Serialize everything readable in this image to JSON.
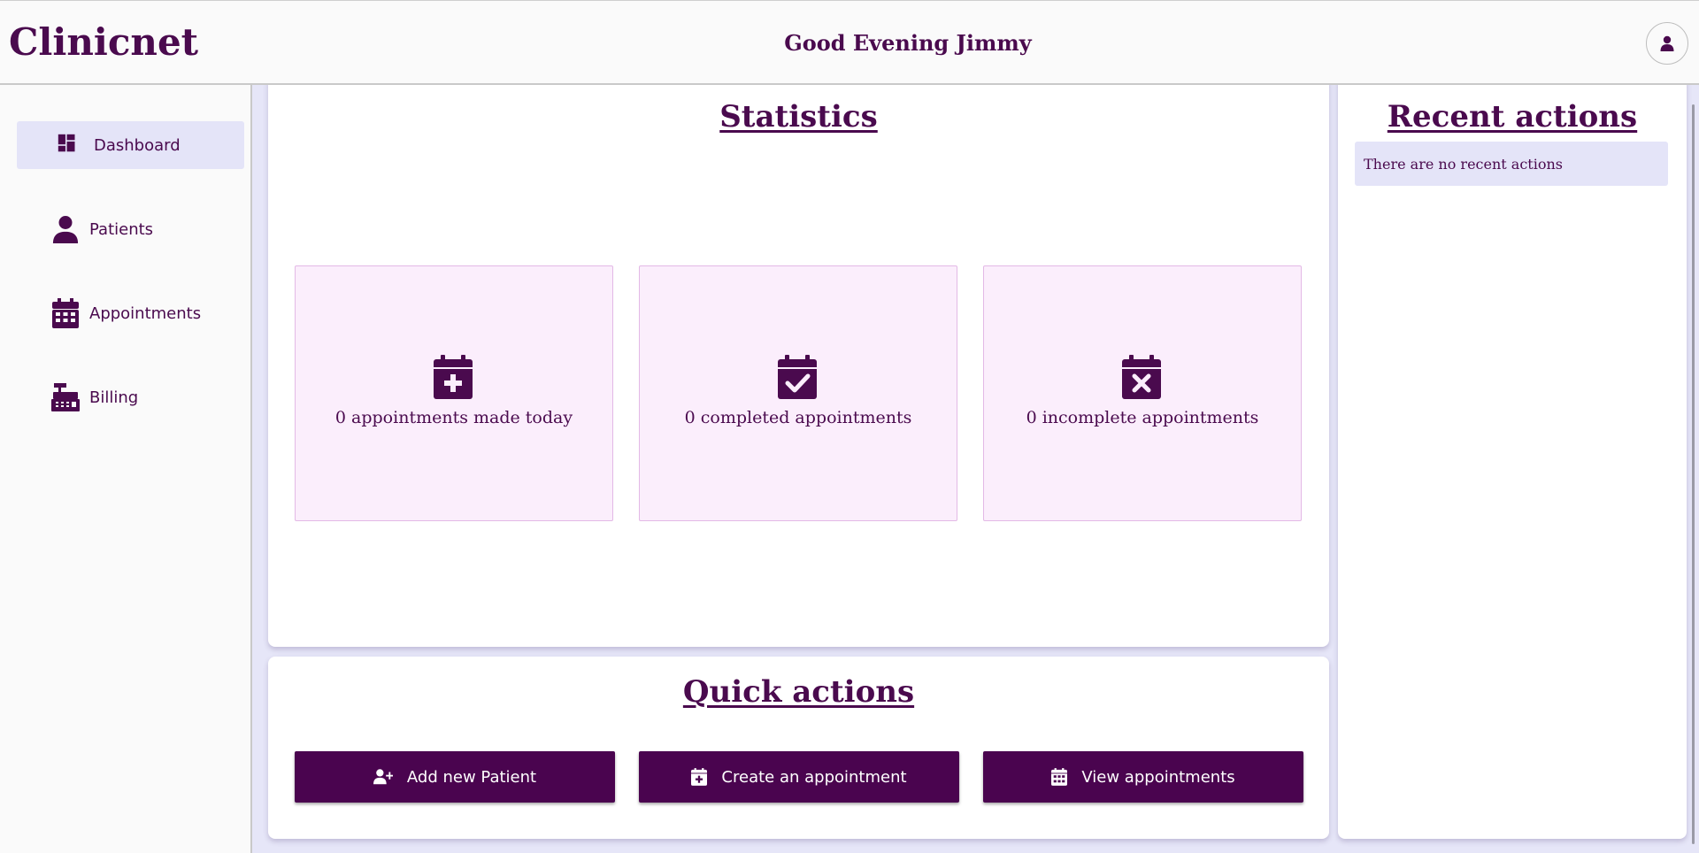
{
  "app": {
    "brand": "Clinicnet",
    "greeting": "Good Evening Jimmy",
    "avatar_icon": "user-icon"
  },
  "sidebar": {
    "items": [
      {
        "label": "Dashboard",
        "icon": "dashboard-icon",
        "active": true
      },
      {
        "label": "Patients",
        "icon": "user-icon",
        "active": false
      },
      {
        "label": "Appointments",
        "icon": "calendar-icon",
        "active": false
      },
      {
        "label": "Billing",
        "icon": "cash-register-icon",
        "active": false
      }
    ]
  },
  "statistics": {
    "title": "Statistics",
    "cards": [
      {
        "icon": "calendar-plus-icon",
        "text": "0 appointments made today"
      },
      {
        "icon": "calendar-check-icon",
        "text": "0 completed appointments"
      },
      {
        "icon": "calendar-xmark-icon",
        "text": "0 incomplete appointments"
      }
    ]
  },
  "quick_actions": {
    "title": "Quick actions",
    "buttons": [
      {
        "label": "Add new Patient",
        "icon": "user-plus-icon"
      },
      {
        "label": "Create an appointment",
        "icon": "calendar-plus-icon"
      },
      {
        "label": "View appointments",
        "icon": "calendar-icon"
      }
    ]
  },
  "recent_actions": {
    "title": "Recent actions",
    "empty_message": "There are no recent actions"
  },
  "colors": {
    "brand": "#4a0a4e",
    "button": "#4a044f",
    "card_bg": "#fbeefc",
    "active_nav": "#e4e4f8",
    "page_bg": "#e6e6f8"
  }
}
